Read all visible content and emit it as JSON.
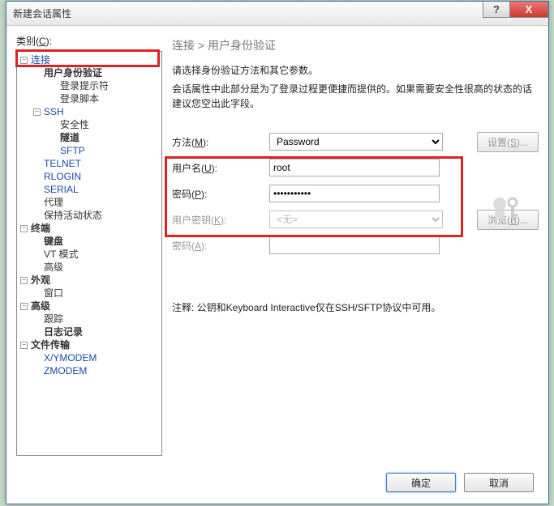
{
  "title": "新建会话属性",
  "category_label": "类别(C):",
  "tree": {
    "items": [
      {
        "label": "连接",
        "lvl": 0,
        "exp": "−",
        "link": true
      },
      {
        "label": "用户身份验证",
        "lvl": 1,
        "bold": true
      },
      {
        "label": "登录提示符",
        "lvl": 2
      },
      {
        "label": "登录脚本",
        "lvl": 2
      },
      {
        "label": "SSH",
        "lvl": 1,
        "exp": "−",
        "link": true
      },
      {
        "label": "安全性",
        "lvl": 2
      },
      {
        "label": "隧道",
        "lvl": 2,
        "bold": true
      },
      {
        "label": "SFTP",
        "lvl": 2,
        "link": true
      },
      {
        "label": "TELNET",
        "lvl": 1,
        "link": true
      },
      {
        "label": "RLOGIN",
        "lvl": 1,
        "link": true
      },
      {
        "label": "SERIAL",
        "lvl": 1,
        "link": true
      },
      {
        "label": "代理",
        "lvl": 1
      },
      {
        "label": "保持活动状态",
        "lvl": 1
      },
      {
        "label": "终端",
        "lvl": 0,
        "exp": "−",
        "bold": true
      },
      {
        "label": "键盘",
        "lvl": 1,
        "bold": true
      },
      {
        "label": "VT 模式",
        "lvl": 1
      },
      {
        "label": "高级",
        "lvl": 1
      },
      {
        "label": "外观",
        "lvl": 0,
        "exp": "−",
        "bold": true
      },
      {
        "label": "窗口",
        "lvl": 1
      },
      {
        "label": "高级",
        "lvl": 0,
        "exp": "−",
        "bold": true
      },
      {
        "label": "跟踪",
        "lvl": 1
      },
      {
        "label": "日志记录",
        "lvl": 1,
        "bold": true
      },
      {
        "label": "文件传输",
        "lvl": 0,
        "exp": "−",
        "bold": true
      },
      {
        "label": "X/YMODEM",
        "lvl": 1,
        "link": true
      },
      {
        "label": "ZMODEM",
        "lvl": 1,
        "link": true
      }
    ]
  },
  "breadcrumb": "连接 > 用户身份验证",
  "desc1": "请选择身份验证方法和其它参数。",
  "desc2": "会话属性中此部分是为了登录过程更便捷而提供的。如果需要安全性很高的状态的话建议您空出此字段。",
  "form": {
    "method_label": "方法(M):",
    "method_value": "Password",
    "settings_btn": "设置(S)...",
    "username_label": "用户名(U):",
    "username_value": "root",
    "password_label": "密码(P):",
    "password_value": "●●●●●●●●●●●",
    "userkey_label": "用户密钥(K):",
    "userkey_value": "<无>",
    "browse_btn": "浏览(B)...",
    "password2_label": "密码(A):"
  },
  "note": "注释: 公钥和Keyboard Interactive仅在SSH/SFTP协议中可用。",
  "buttons": {
    "ok": "确定",
    "cancel": "取消"
  },
  "titlebar": {
    "help": "?",
    "close": "X"
  }
}
